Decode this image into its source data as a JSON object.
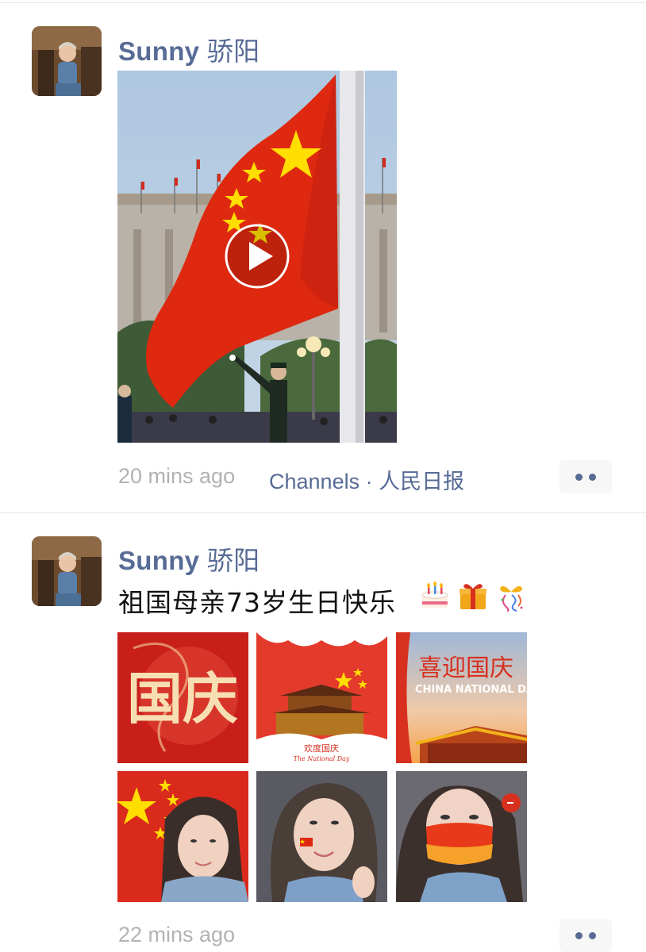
{
  "posts": [
    {
      "user": {
        "name_latin": "Sunny",
        "name_cjk": "骄阳"
      },
      "video": {
        "type": "video",
        "play_icon": "play-icon"
      },
      "time": "20 mins ago",
      "source": "Channels · 人民日报",
      "more_icon": "more-dots-icon"
    },
    {
      "user": {
        "name_latin": "Sunny",
        "name_cjk": "骄阳"
      },
      "text": "祖国母亲73岁生日快乐",
      "emojis": [
        "birthday-cake-icon",
        "gift-icon",
        "ribbon-icon"
      ],
      "images": [
        {
          "name": "image-national-day-calligraphy",
          "caption": "国庆"
        },
        {
          "name": "image-tiananmen-illustration",
          "caption": "欢度国庆",
          "subcaption": "The National Day"
        },
        {
          "name": "image-welcome-national-day",
          "caption": "喜迎国庆",
          "subcaption": "CHINA NATIONAL DA"
        },
        {
          "name": "image-selfie-flag-background"
        },
        {
          "name": "image-selfie-flag-sticker"
        },
        {
          "name": "image-selfie-red-mask"
        }
      ],
      "time": "22 mins ago",
      "more_icon": "more-dots-icon"
    }
  ],
  "colors": {
    "link_blue": "#576b95",
    "time_gray": "#b2b2b2",
    "flag_red": "#de2910",
    "star_yellow": "#ffde00"
  }
}
